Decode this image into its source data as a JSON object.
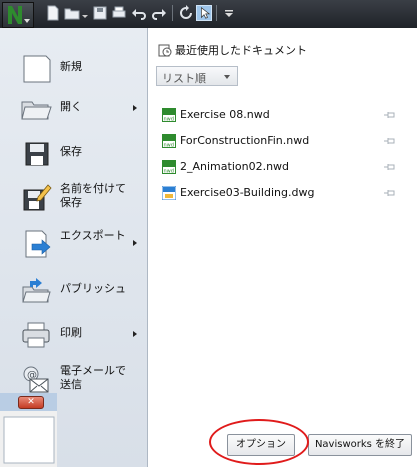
{
  "quick_access": {
    "icons": [
      "app-menu-icon",
      "new-file-icon",
      "open-folder-icon",
      "save-icon",
      "print-icon",
      "undo-icon",
      "redo-icon",
      "refresh-icon",
      "select-cursor-icon",
      "customize-dropdown-icon"
    ]
  },
  "menu": {
    "items": [
      {
        "label": "新規",
        "icon": "new-document-icon",
        "submenu": false
      },
      {
        "label": "開く",
        "icon": "open-folder-icon",
        "submenu": true
      },
      {
        "label": "保存",
        "icon": "save-disk-icon",
        "submenu": false
      },
      {
        "label": "名前を付けて保存",
        "icon": "save-as-icon",
        "submenu": false
      },
      {
        "label": "エクスポート",
        "icon": "export-icon",
        "submenu": true
      },
      {
        "label": "パブリッシュ",
        "icon": "publish-icon",
        "submenu": false
      },
      {
        "label": "印刷",
        "icon": "printer-icon",
        "submenu": true
      },
      {
        "label": "電子メールで送信",
        "icon": "email-icon",
        "submenu": false
      }
    ]
  },
  "recent": {
    "title": "最近使用したドキュメント",
    "sort_label": "リスト順",
    "documents": [
      {
        "name": "Exercise 08.nwd",
        "type": "nwd"
      },
      {
        "name": "ForConstructionFin.nwd",
        "type": "nwd"
      },
      {
        "name": "2_Animation02.nwd",
        "type": "nwd"
      },
      {
        "name": "Exercise03-Building.dwg",
        "type": "dwg"
      }
    ]
  },
  "footer": {
    "options_label": "オプション",
    "exit_label": "Navisworks を終了"
  },
  "colors": {
    "annotation": "#e01b1b",
    "app_icon_green": "#2e8b2e",
    "menu_bg": "#dfe5ec"
  }
}
